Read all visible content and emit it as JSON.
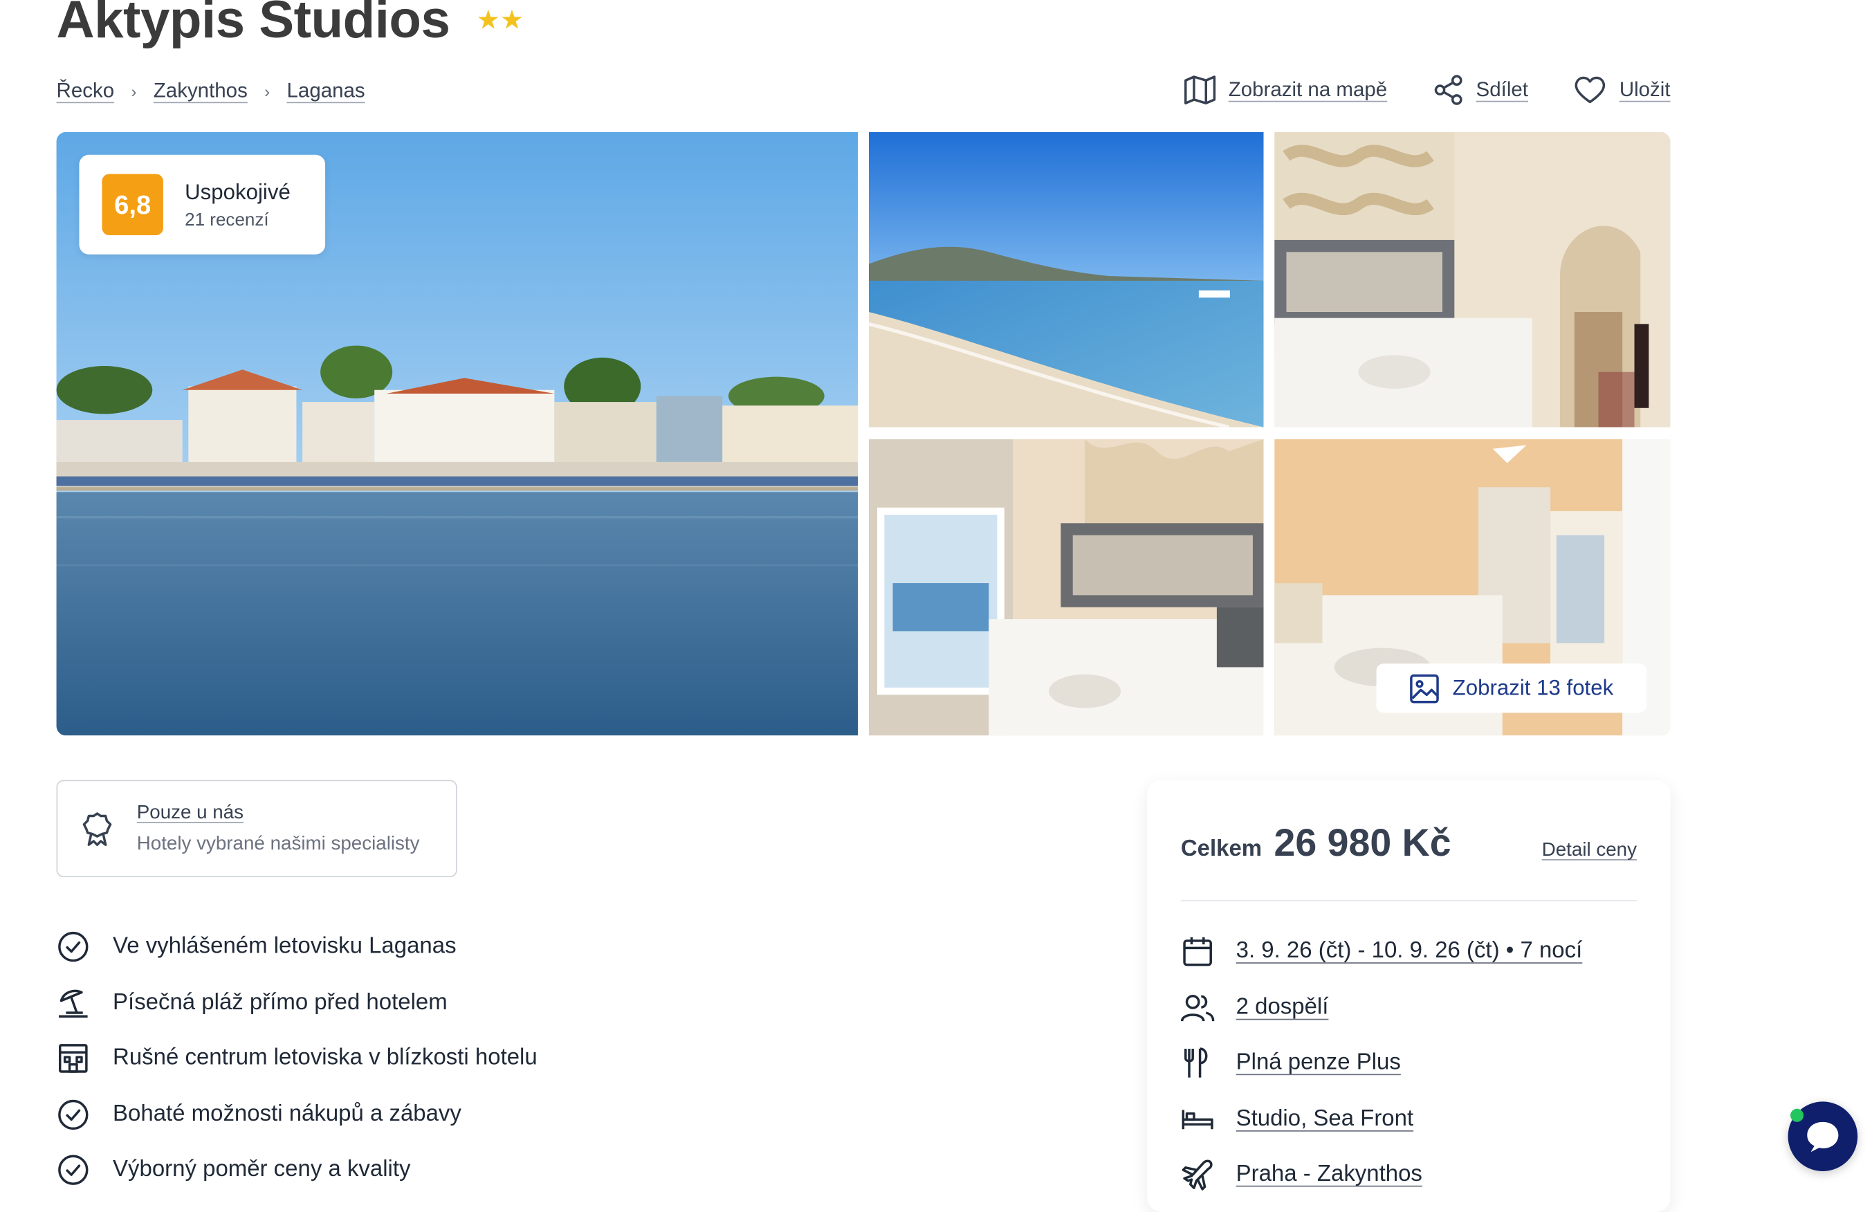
{
  "hotel": {
    "name": "Aktypis Studios",
    "stars": "★★"
  },
  "breadcrumb": {
    "items": [
      "Řecko",
      "Zakynthos",
      "Laganas"
    ]
  },
  "actions": {
    "map": "Zobrazit na mapě",
    "share": "Sdílet",
    "save": "Uložit"
  },
  "rating": {
    "score": "6,8",
    "label": "Uspokojivé",
    "count": "21 recenzí"
  },
  "gallery": {
    "show_photos": "Zobrazit 13 fotek"
  },
  "exclusive": {
    "title": "Pouze u nás",
    "subtitle": "Hotely vybrané našimi specialisty"
  },
  "features": [
    {
      "icon": "check-circle-icon",
      "text": "Ve vyhlášeném letovisku Laganas"
    },
    {
      "icon": "beach-umbrella-icon",
      "text": "Písečná pláž přímo před hotelem"
    },
    {
      "icon": "building-icon",
      "text": "Rušné centrum letoviska v blízkosti hotelu"
    },
    {
      "icon": "check-circle-icon",
      "text": "Bohaté možnosti nákupů a zábavy"
    },
    {
      "icon": "check-circle-icon",
      "text": "Výborný poměr ceny a kvality"
    }
  ],
  "booking": {
    "total_label": "Celkem",
    "total_price": "26 980 Kč",
    "detail_link": "Detail ceny",
    "items": [
      {
        "icon": "calendar-icon",
        "text": "3. 9. 26 (čt) - 10. 9. 26 (čt) • 7 nocí"
      },
      {
        "icon": "people-icon",
        "text": "2 dospělí"
      },
      {
        "icon": "cutlery-icon",
        "text": "Plná penze Plus"
      },
      {
        "icon": "bed-icon",
        "text": "Studio, Sea Front"
      },
      {
        "icon": "plane-icon",
        "text": "Praha - Zakynthos"
      }
    ]
  },
  "colors": {
    "rating_badge": "#f5a014",
    "star": "#f4c21f",
    "chat_button": "#0f1f6b",
    "link_blue": "#1e3a8a"
  }
}
